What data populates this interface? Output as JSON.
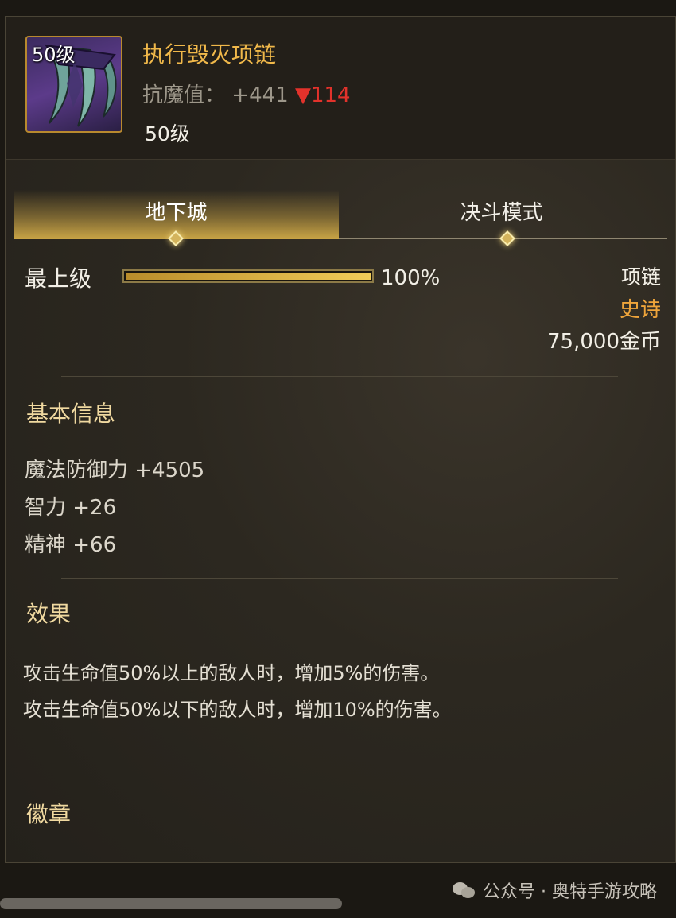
{
  "item": {
    "icon_level_tag": "50级",
    "name": "执行毁灭项链",
    "stat_label": "抗魔值：",
    "stat_value": "+441",
    "stat_change": "▼114",
    "level": "50级",
    "icon": "claw-necklace-icon"
  },
  "tabs": [
    {
      "label": "地下城",
      "active": true
    },
    {
      "label": "决斗模式",
      "active": false
    }
  ],
  "grade": {
    "label": "最上级",
    "percent_text": "100%",
    "fill_fraction": 1.0
  },
  "meta": {
    "type": "项链",
    "rarity": "史诗",
    "price": "75,000金币"
  },
  "basic_info": {
    "title": "基本信息",
    "attributes": [
      "魔法防御力 +4505",
      "智力 +26",
      "精神 +66"
    ]
  },
  "effects": {
    "title": "效果",
    "lines": [
      "攻击生命值50%以上的敌人时，增加5%的伤害。",
      "攻击生命值50%以下的敌人时，增加10%的伤害。"
    ]
  },
  "badge": {
    "title": "徽章"
  },
  "watermark": {
    "text": "公众号 · 奥特手游攻略",
    "icon": "wechat-icon"
  },
  "colors": {
    "accent_gold": "#f0b84a",
    "rarity_epic": "#efa53b",
    "stat_down": "#e2322b"
  }
}
